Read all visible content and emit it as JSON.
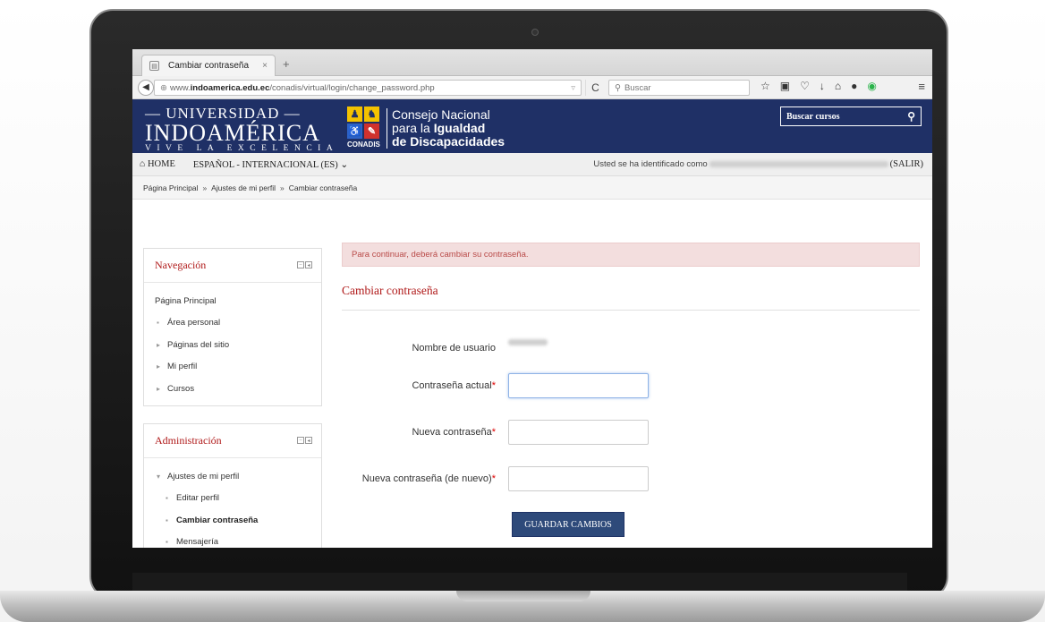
{
  "browser": {
    "tab_title": "Cambiar contraseña",
    "tab_close": "×",
    "new_tab": "+",
    "url_prefix": "www.",
    "url_domain": "indoamerica.edu.ec",
    "url_path": "/conadis/virtual/login/change_password.php",
    "search_placeholder": "Buscar"
  },
  "header": {
    "logo_line1": "— UNIVERSIDAD —",
    "logo_line2": "INDOAMÉRICA",
    "logo_line3": "VIVE LA EXCELENCIA",
    "conadis_label": "CONADIS",
    "conadis_line1": "Consejo Nacional",
    "conadis_line2a": "para la ",
    "conadis_line2b": "Igualdad",
    "conadis_line3": "de Discapacidades",
    "search_courses": "Buscar cursos"
  },
  "navbar": {
    "home": "HOME",
    "language": "ESPAÑOL - INTERNACIONAL (ES)",
    "identified": "Usted se ha identificado como",
    "logout": "(SALIR)"
  },
  "breadcrumb": {
    "items": [
      "Página Principal",
      "Ajustes de mi perfil",
      "Cambiar contraseña"
    ],
    "separator": "»"
  },
  "sidebar": {
    "navigation": {
      "title": "Navegación",
      "items": [
        "Página Principal",
        "Área personal",
        "Páginas del sitio",
        "Mi perfil",
        "Cursos"
      ]
    },
    "administration": {
      "title": "Administración",
      "items": [
        "Ajustes de mi perfil",
        "Editar perfil",
        "Cambiar contraseña",
        "Mensajería"
      ]
    }
  },
  "main": {
    "alert": "Para continuar, deberá cambiar su contraseña.",
    "title": "Cambiar contraseña",
    "username_label": "Nombre de usuario",
    "current_password_label": "Contraseña actual",
    "new_password_label": "Nueva contraseña",
    "new_password_again_label": "Nueva contraseña (de nuevo)",
    "required_mark": "*",
    "save_button": "GUARDAR CAMBIOS"
  }
}
